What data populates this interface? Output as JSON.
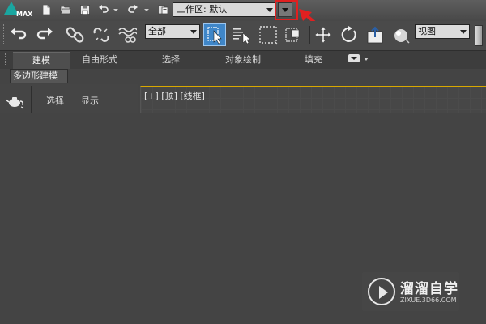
{
  "titlebar": {
    "app_logo_text": "MAX",
    "workspace_label": "工作区: 默认",
    "quick_access_icons": [
      "new-file-icon",
      "open-folder-icon",
      "save-icon",
      "undo-icon",
      "undo-dropdown-icon",
      "redo-icon",
      "redo-dropdown-icon",
      "project-folder-icon"
    ],
    "customize_icon": "customize-dropdown-icon"
  },
  "toolbar": {
    "selection_filter": "全部",
    "reference_coordinate": "视图",
    "icons": [
      "undo-icon",
      "redo-icon",
      "link-icon",
      "unlink-icon",
      "bind-spacewarp-icon",
      "select-object-icon",
      "select-by-name-icon",
      "rect-selection-icon",
      "window-crossing-icon",
      "move-icon",
      "rotate-icon",
      "scale-icon",
      "teapot-render-icon"
    ]
  },
  "ribbon": {
    "tabs": [
      {
        "label": "建模",
        "active": true
      },
      {
        "label": "自由形式",
        "active": false
      },
      {
        "label": "选择",
        "active": false
      },
      {
        "label": "对象绘制",
        "active": false
      },
      {
        "label": "填充",
        "active": false
      }
    ],
    "panel_label": "多边形建模"
  },
  "explorer": {
    "menu": [
      "选择",
      "显示"
    ]
  },
  "viewport": {
    "label": "[+] [顶] [线框]"
  },
  "watermark": {
    "title": "溜溜自学",
    "url": "ZIXUE.3D66.COM"
  },
  "colors": {
    "highlight": "#e12020",
    "active_selection": "#3f86c8",
    "viewport_border": "#d9a800"
  }
}
